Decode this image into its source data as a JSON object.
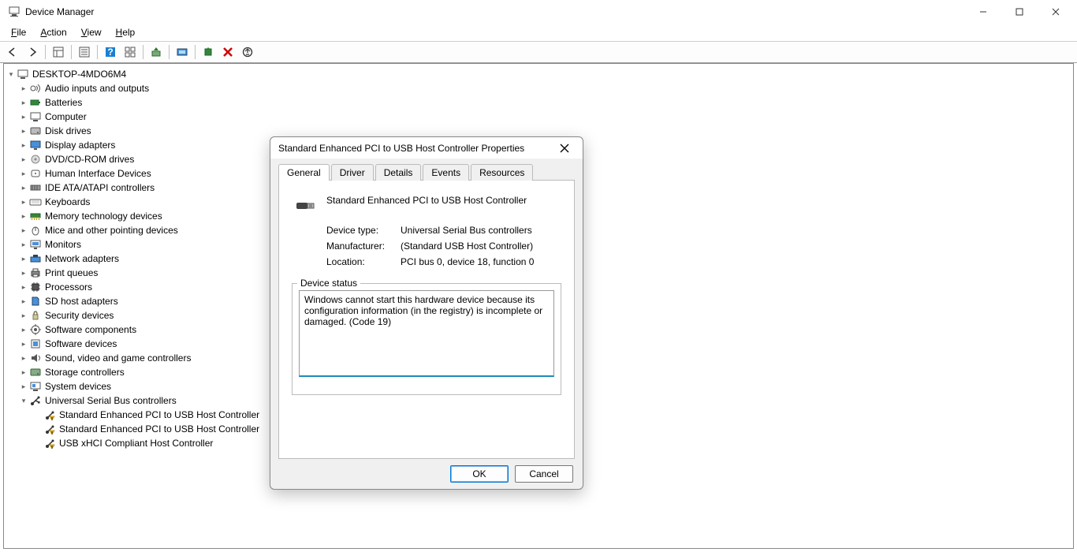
{
  "window": {
    "title": "Device Manager"
  },
  "menu": {
    "file": "File",
    "action": "Action",
    "view": "View",
    "help": "Help"
  },
  "tree": {
    "root": "DESKTOP-4MDO6M4",
    "nodes": [
      {
        "label": "Audio inputs and outputs",
        "icon": "audio"
      },
      {
        "label": "Batteries",
        "icon": "battery"
      },
      {
        "label": "Computer",
        "icon": "computer"
      },
      {
        "label": "Disk drives",
        "icon": "disk"
      },
      {
        "label": "Display adapters",
        "icon": "display"
      },
      {
        "label": "DVD/CD-ROM drives",
        "icon": "dvd"
      },
      {
        "label": "Human Interface Devices",
        "icon": "hid"
      },
      {
        "label": "IDE ATA/ATAPI controllers",
        "icon": "ide"
      },
      {
        "label": "Keyboards",
        "icon": "keyboard"
      },
      {
        "label": "Memory technology devices",
        "icon": "memory"
      },
      {
        "label": "Mice and other pointing devices",
        "icon": "mouse"
      },
      {
        "label": "Monitors",
        "icon": "monitor"
      },
      {
        "label": "Network adapters",
        "icon": "network"
      },
      {
        "label": "Print queues",
        "icon": "printer"
      },
      {
        "label": "Processors",
        "icon": "cpu"
      },
      {
        "label": "SD host adapters",
        "icon": "sd"
      },
      {
        "label": "Security devices",
        "icon": "security"
      },
      {
        "label": "Software components",
        "icon": "swcomp"
      },
      {
        "label": "Software devices",
        "icon": "swdev"
      },
      {
        "label": "Sound, video and game controllers",
        "icon": "sound"
      },
      {
        "label": "Storage controllers",
        "icon": "storage"
      },
      {
        "label": "System devices",
        "icon": "system"
      }
    ],
    "usb": {
      "label": "Universal Serial Bus controllers",
      "children": [
        "Standard Enhanced PCI to USB Host Controller",
        "Standard Enhanced PCI to USB Host Controller",
        "USB xHCI Compliant Host Controller"
      ]
    }
  },
  "dialog": {
    "title": "Standard Enhanced PCI to USB Host Controller Properties",
    "tabs": {
      "general": "General",
      "driver": "Driver",
      "details": "Details",
      "events": "Events",
      "resources": "Resources"
    },
    "device_name": "Standard Enhanced PCI to USB Host Controller",
    "props": {
      "device_type_label": "Device type:",
      "device_type": "Universal Serial Bus controllers",
      "manufacturer_label": "Manufacturer:",
      "manufacturer": "(Standard USB Host Controller)",
      "location_label": "Location:",
      "location": "PCI bus 0, device 18, function 0"
    },
    "status_label": "Device status",
    "status_text": "Windows cannot start this hardware device because its configuration information (in the registry) is incomplete or damaged. (Code 19)",
    "ok": "OK",
    "cancel": "Cancel"
  }
}
